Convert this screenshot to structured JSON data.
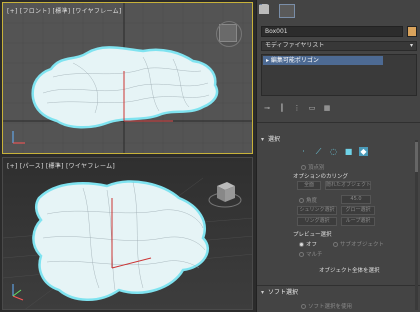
{
  "viewport_top": {
    "label": "[+] [フロント] [標準] [ワイヤフレーム]"
  },
  "viewport_bottom": {
    "label": "[+] [パース] [標準] [ワイヤフレーム]"
  },
  "panel": {
    "object_name": "Box001",
    "object_color": "#d9a35c",
    "modifier_list": "モディファイヤリスト",
    "stack_item": "編集可能ポリゴン",
    "rollout_selection": "選択",
    "by_vertex": "頂点別",
    "soft_selection_title": "ソフト選択",
    "use_soft_selection": "ソフト選択を使用",
    "section_occluded": "オプションのカリング",
    "btn_front": "全面",
    "btn_hidden": "隠れたオブジェクト",
    "shrink": "角度",
    "shrink_value": "45.0",
    "btn_shrink": "シュリンク選択",
    "btn_grow": "グロー選択",
    "btn_ring": "リング選択",
    "btn_loop": "ループ選択",
    "preview_title": "プレビュー選択",
    "preview_off": "オフ",
    "preview_subobj": "サブオブジェクト",
    "preview_multi": "マルチ",
    "status_text": "オブジェクト全体を選択"
  }
}
